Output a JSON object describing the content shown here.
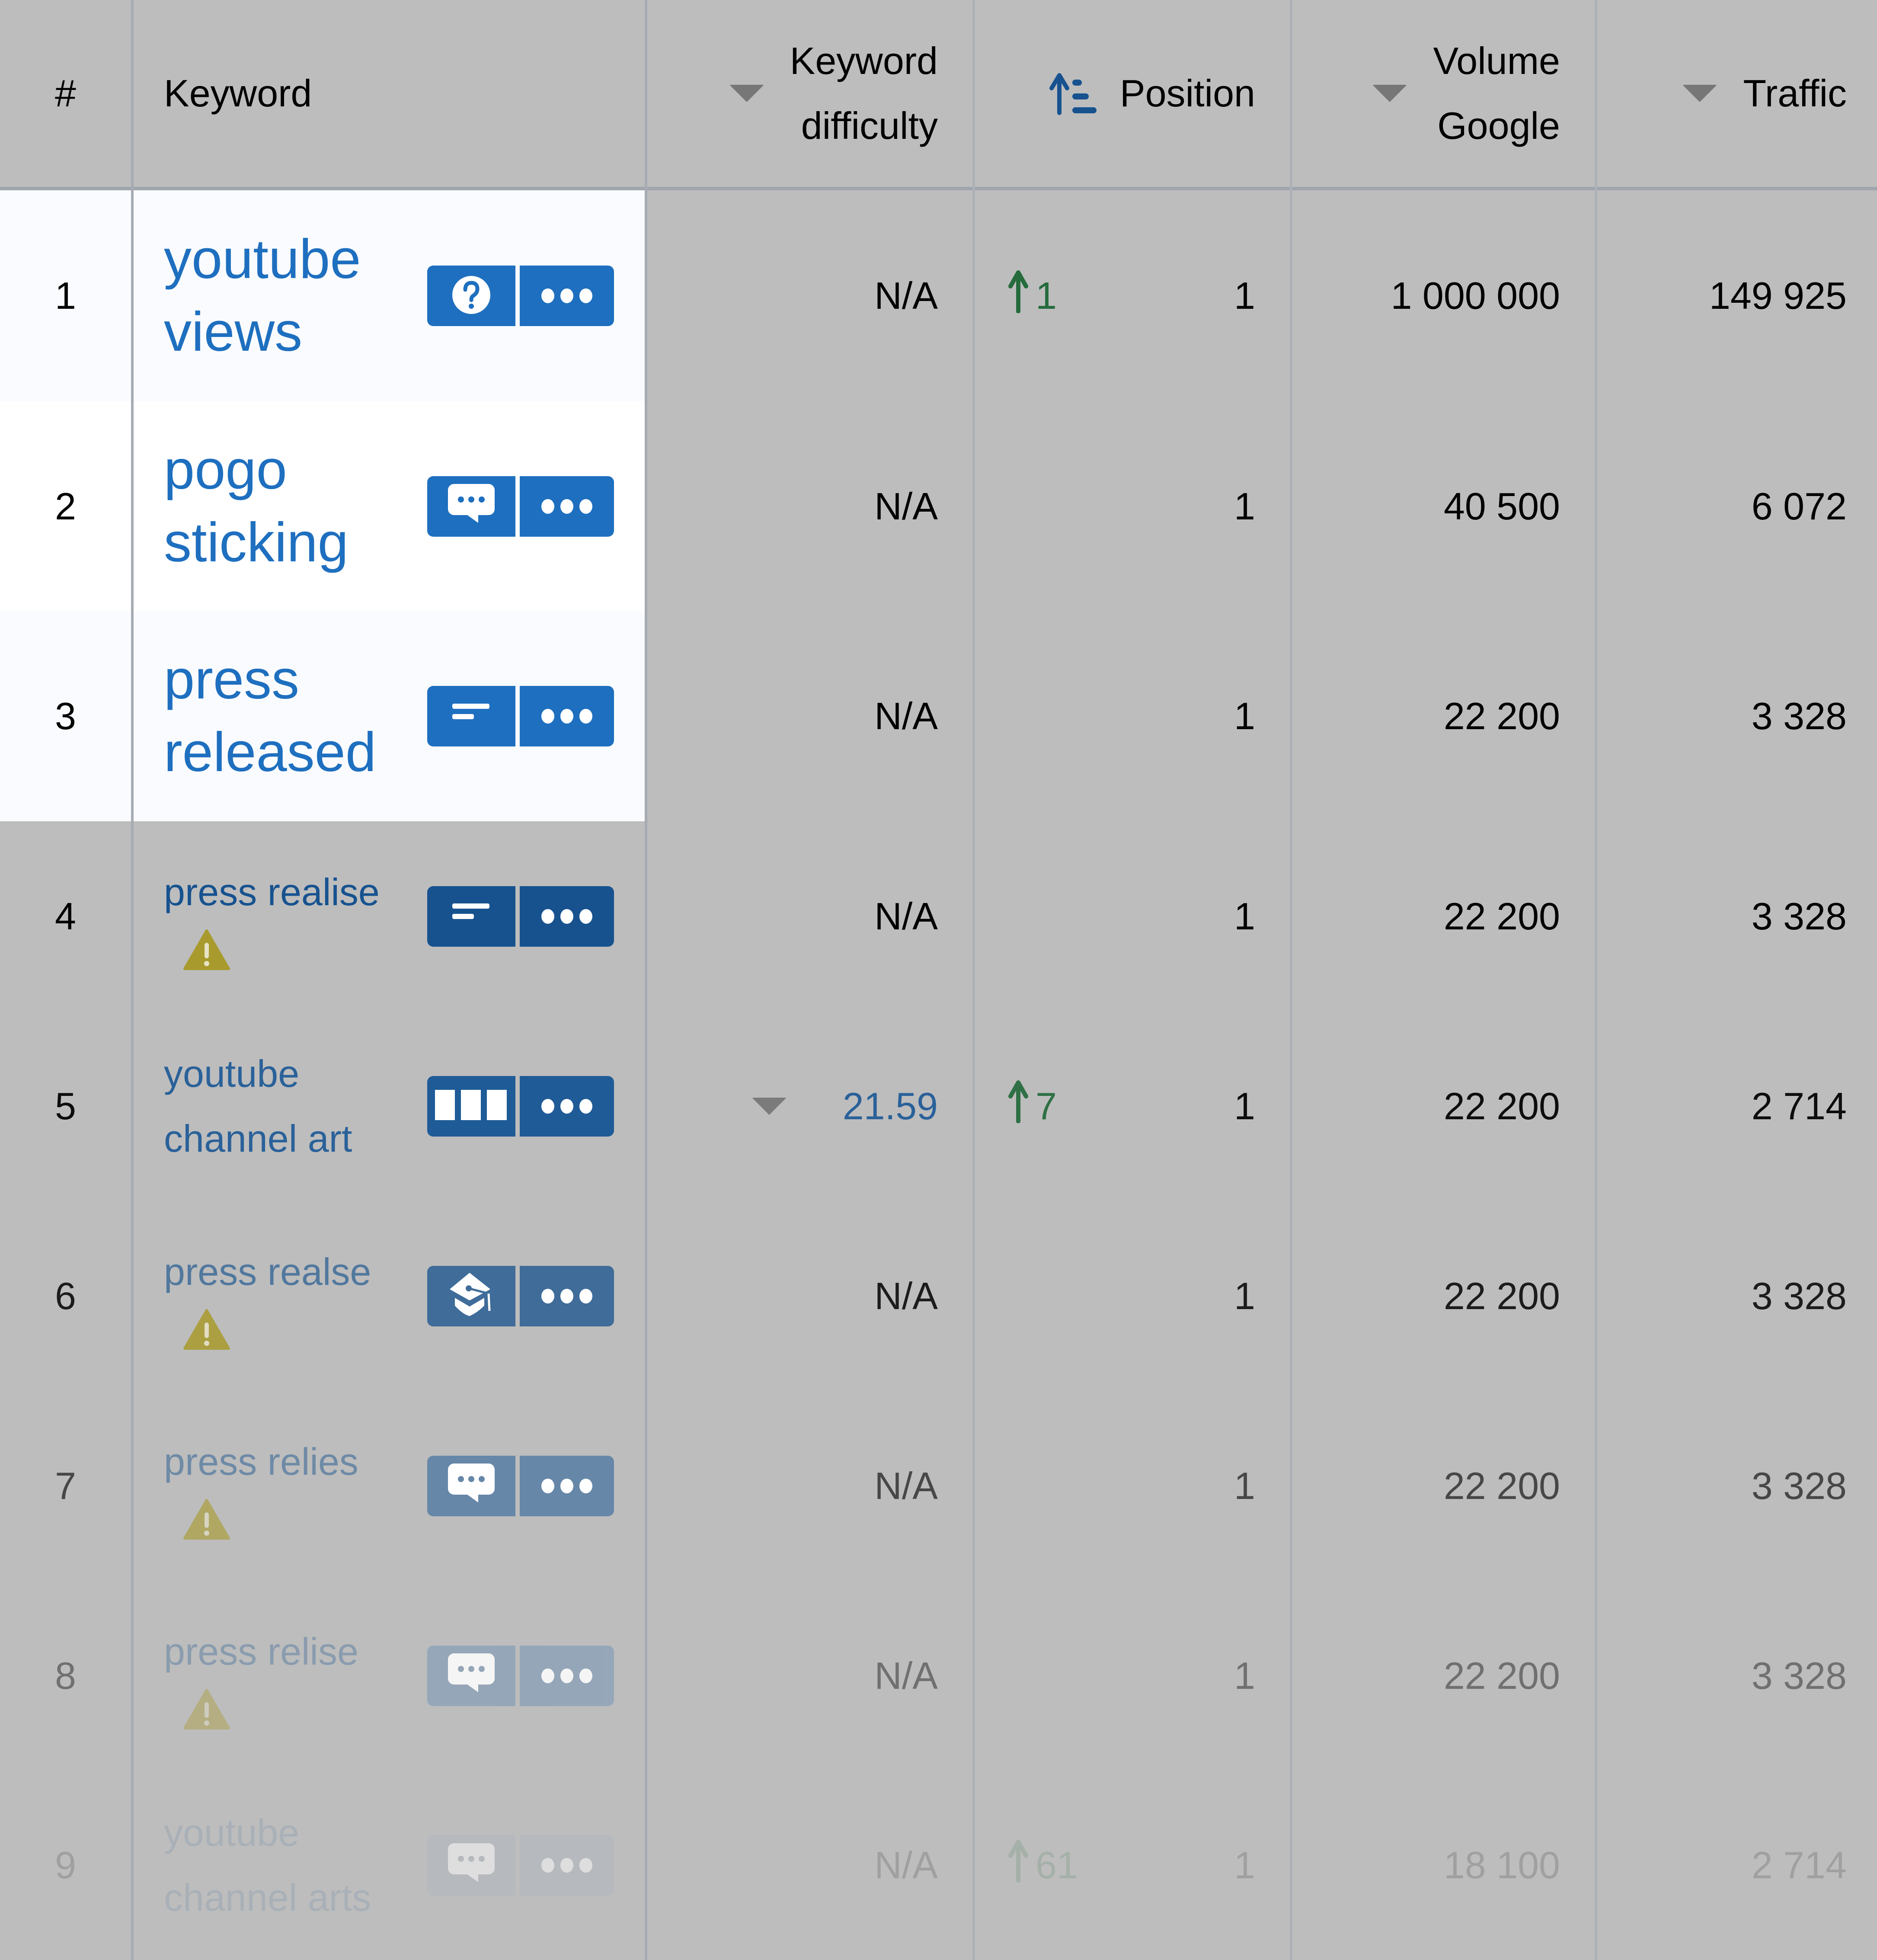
{
  "header": {
    "num": "#",
    "keyword": "Keyword",
    "kd_line1": "Keyword",
    "kd_line2": "difficulty",
    "position": "Position",
    "volume_line1": "Volume",
    "volume_line2": "Google",
    "traffic": "Traffic"
  },
  "colors": {
    "link_blue": "#1e6fbf",
    "button_blue": "#1e6fbf",
    "change_green": "#256b3c",
    "warning_yellow": "#a89a2c",
    "overlay_grey": "#bdbdbd"
  },
  "rows": [
    {
      "num": "1",
      "keyword": "youtube views",
      "intent_icon": "question-icon",
      "warning": false,
      "kd": "N/A",
      "change": "1",
      "position": "1",
      "volume": "1 000 000",
      "traffic": "149 925"
    },
    {
      "num": "2",
      "keyword": "pogo sticking",
      "intent_icon": "chat-bubble-icon",
      "warning": false,
      "kd": "N/A",
      "change": "",
      "position": "1",
      "volume": "40 500",
      "traffic": "6 072"
    },
    {
      "num": "3",
      "keyword": "press released",
      "intent_icon": "text-lines-icon",
      "warning": false,
      "kd": "N/A",
      "change": "",
      "position": "1",
      "volume": "22 200",
      "traffic": "3 328"
    },
    {
      "num": "4",
      "keyword": "press realise",
      "intent_icon": "text-lines-icon",
      "warning": true,
      "kd": "N/A",
      "change": "",
      "position": "1",
      "volume": "22 200",
      "traffic": "3 328"
    },
    {
      "num": "5",
      "keyword": "youtube channel art",
      "intent_icon": "columns-icon",
      "warning": false,
      "kd": "21.59",
      "change": "7",
      "position": "1",
      "volume": "22 200",
      "traffic": "2 714"
    },
    {
      "num": "6",
      "keyword": "press realse",
      "intent_icon": "graduation-cap-icon",
      "warning": true,
      "kd": "N/A",
      "change": "",
      "position": "1",
      "volume": "22 200",
      "traffic": "3 328"
    },
    {
      "num": "7",
      "keyword": "press relies",
      "intent_icon": "chat-bubble-icon",
      "warning": true,
      "kd": "N/A",
      "change": "",
      "position": "1",
      "volume": "22 200",
      "traffic": "3 328"
    },
    {
      "num": "8",
      "keyword": "press relise",
      "intent_icon": "chat-bubble-icon",
      "warning": true,
      "kd": "N/A",
      "change": "",
      "position": "1",
      "volume": "22 200",
      "traffic": "3 328"
    },
    {
      "num": "9",
      "keyword": "youtube channel arts",
      "intent_icon": "chat-bubble-icon",
      "warning": false,
      "kd": "N/A",
      "change": "61",
      "position": "1",
      "volume": "18 100",
      "traffic": "2 714"
    }
  ]
}
